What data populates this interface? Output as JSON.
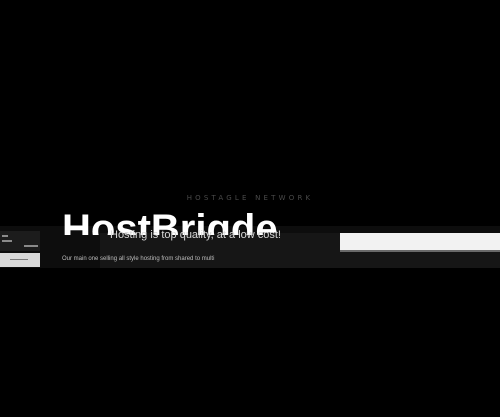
{
  "hero": {
    "network_label": "HOSTAGLE NETWORK",
    "title": "HostBrigde",
    "tagline": "Hosting is top quality, at a low cost!",
    "subtext": "Our main one selling all style hosting from shared to multi"
  },
  "search": {
    "value": "",
    "placeholder": ""
  },
  "colors": {
    "background": "#000000",
    "band": "#161616",
    "input": "#f2f2f2",
    "title": "#ffffff"
  }
}
